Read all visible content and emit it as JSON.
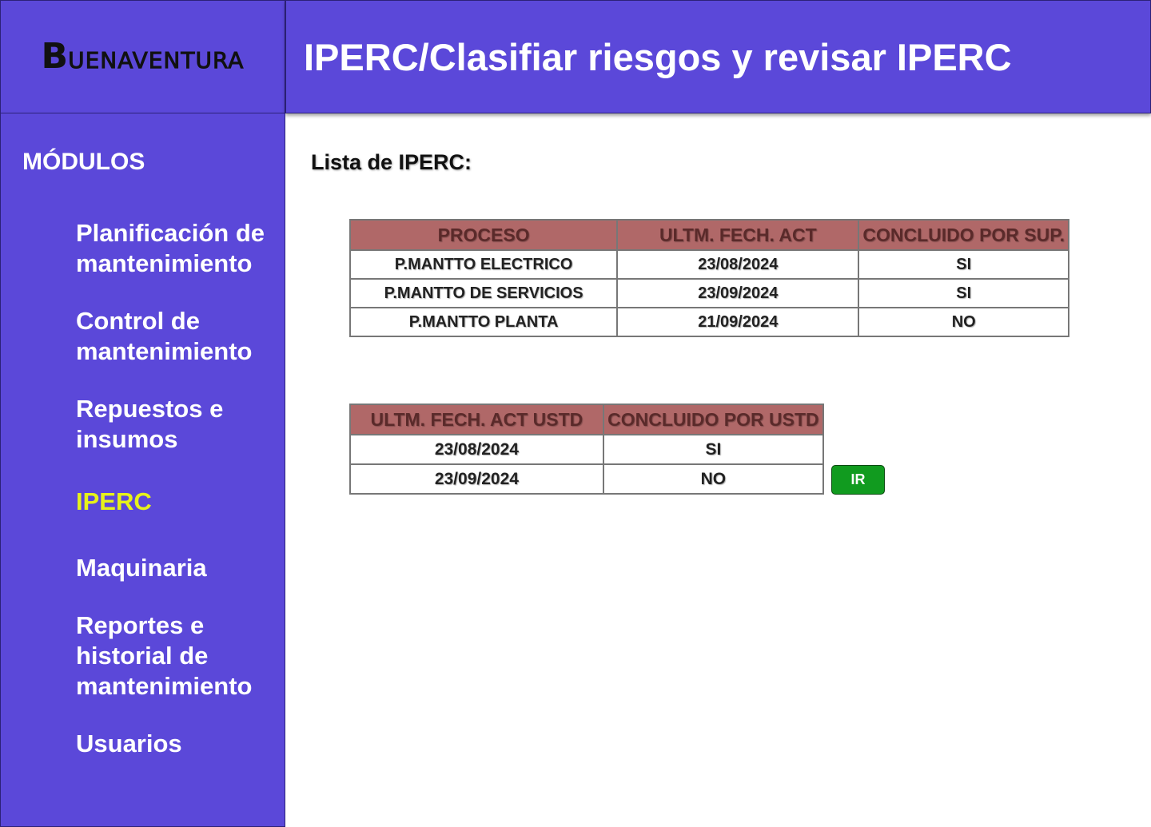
{
  "logo": {
    "initial": "B",
    "rest": "UENAVENTURA"
  },
  "header": {
    "title": "IPERC/Clasifiar riesgos y revisar IPERC"
  },
  "sidebar": {
    "title": "MÓDULOS",
    "items": [
      {
        "label": "Planificación de mantenimiento"
      },
      {
        "label": "Control de mantenimiento"
      },
      {
        "label": "Repuestos e insumos"
      },
      {
        "label": "IPERC",
        "active": true
      },
      {
        "label": "Maquinaria"
      },
      {
        "label": "Reportes e historial de mantenimiento"
      },
      {
        "label": "Usuarios"
      }
    ]
  },
  "main": {
    "section_title": "Lista de IPERC:",
    "table1": {
      "headers": [
        "PROCESO",
        "ULTM. FECH. ACT",
        "CONCLUIDO POR SUP."
      ],
      "rows": [
        [
          "P.MANTTO ELECTRICO",
          "23/08/2024",
          "SI"
        ],
        [
          "P.MANTTO DE  SERVICIOS",
          "23/09/2024",
          "SI"
        ],
        [
          "P.MANTTO PLANTA",
          "21/09/2024",
          "NO"
        ]
      ]
    },
    "table2": {
      "headers": [
        "ULTM. FECH. ACT USTD",
        "CONCLUIDO POR USTD"
      ],
      "rows": [
        [
          "23/08/2024",
          "SI"
        ],
        [
          "23/09/2024",
          "NO"
        ]
      ]
    },
    "ir_button": "IR"
  },
  "colors": {
    "primary": "#5b48d9",
    "active_nav": "#e6f21a",
    "table_header": "#b06868",
    "button_green": "#119b1f"
  }
}
